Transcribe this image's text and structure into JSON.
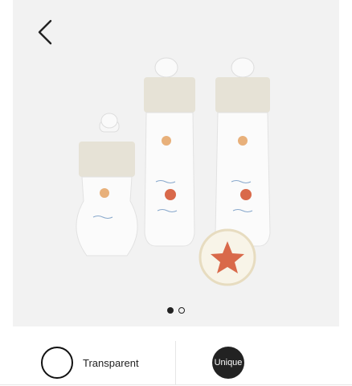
{
  "gallery": {
    "back_icon": "chevron-left-icon",
    "image_count": 2,
    "active_index": 1
  },
  "variants": [
    {
      "label": "Transparent",
      "selected": true
    },
    {
      "label": "Unique",
      "swatch_color": "#222222"
    }
  ],
  "colors": {
    "gallery_bg": "#f2f2f2",
    "bottle_cap": "#e6e2d6",
    "starfish": "#d9694a"
  }
}
